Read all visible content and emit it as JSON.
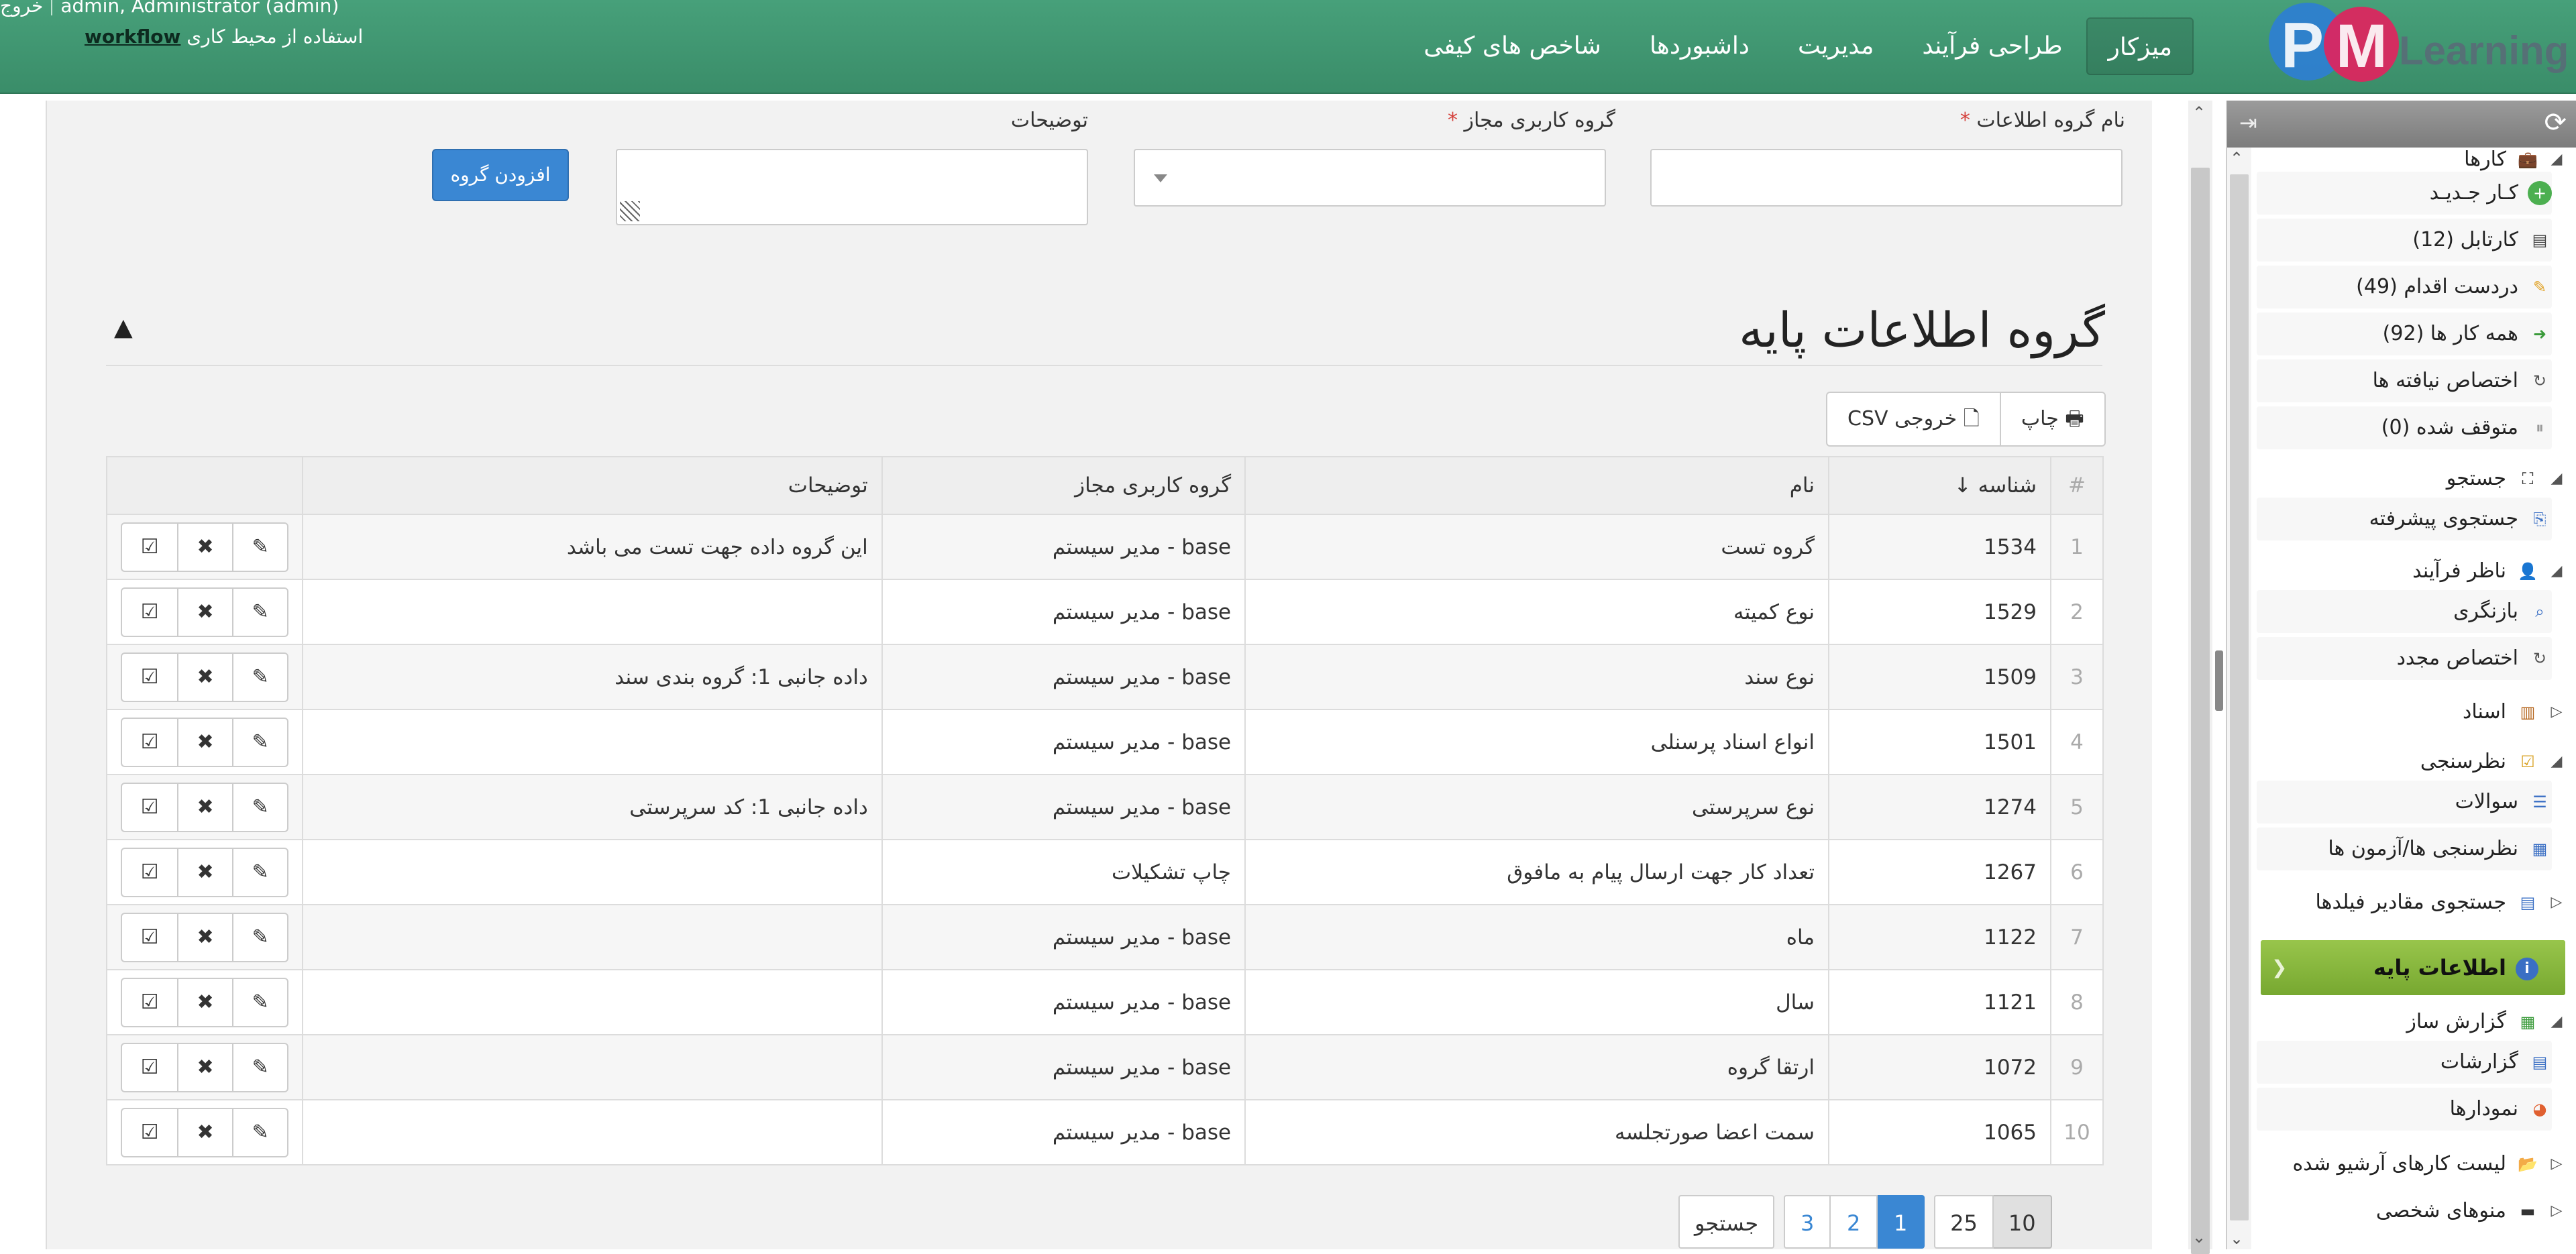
{
  "header": {
    "user_text": "admin, Administrator (admin)",
    "logout_label": "خروج",
    "workspace_prefix": "استفاده از محیط کاری",
    "workspace_name": "workflow",
    "logo_text": "Learning",
    "nav": [
      {
        "label": "میزکار",
        "active": true
      },
      {
        "label": "طراحی فرآیند"
      },
      {
        "label": "مدیریت"
      },
      {
        "label": "داشبوردها"
      },
      {
        "label": "شاخص های کیفی"
      }
    ]
  },
  "form": {
    "group_name_label": "نام گروه اطلاعات",
    "user_group_label": "گروه کاربری مجاز",
    "description_label": "توضیحات",
    "required_mark": "*",
    "add_button": "افزودن گروه"
  },
  "section": {
    "title": "گروه اطلاعات پایه",
    "print_label": "چاپ",
    "csv_label": "خروجی CSV"
  },
  "table": {
    "headers": {
      "index": "#",
      "id": "شناسه ↓",
      "name": "نام",
      "user_group": "گروه کاربری مجاز",
      "description": "توضیحات"
    },
    "rows": [
      {
        "index": "1",
        "id": "1534",
        "name": "گروه تست",
        "user_group": "base - مدیر سیستم",
        "description": "این گروه داده جهت تست می باشد"
      },
      {
        "index": "2",
        "id": "1529",
        "name": "نوع کمیته",
        "user_group": "base - مدیر سیستم",
        "description": ""
      },
      {
        "index": "3",
        "id": "1509",
        "name": "نوع سند",
        "user_group": "base - مدیر سیستم",
        "description": "داده جانبی 1: گروه بندی سند"
      },
      {
        "index": "4",
        "id": "1501",
        "name": "انواع اسناد پرسنلی",
        "user_group": "base - مدیر سیستم",
        "description": ""
      },
      {
        "index": "5",
        "id": "1274",
        "name": "نوع سرپرستی",
        "user_group": "base - مدیر سیستم",
        "description": "داده جانبی 1: کد سرپرستی"
      },
      {
        "index": "6",
        "id": "1267",
        "name": "تعداد کار جهت ارسال پیام به مافوق",
        "user_group": "چاپ تشکیلات",
        "description": ""
      },
      {
        "index": "7",
        "id": "1122",
        "name": "ماه",
        "user_group": "base - مدیر سیستم",
        "description": ""
      },
      {
        "index": "8",
        "id": "1121",
        "name": "سال",
        "user_group": "base - مدیر سیستم",
        "description": ""
      },
      {
        "index": "9",
        "id": "1072",
        "name": "ارتقا گروه",
        "user_group": "base - مدیر سیستم",
        "description": ""
      },
      {
        "index": "10",
        "id": "1065",
        "name": "سمت اعضا صورتجلسه",
        "user_group": "base - مدیر سیستم",
        "description": ""
      }
    ]
  },
  "pager": {
    "page_sizes": [
      "10",
      "25"
    ],
    "active_page_size": "10",
    "pages": [
      "1",
      "2",
      "3"
    ],
    "active_page": "1",
    "search_label": "جستجو"
  },
  "sidebar": {
    "items": [
      {
        "label": "کارها",
        "type": "group",
        "icon": "briefcase-icon"
      },
      {
        "label": "کـار جـدیـد",
        "type": "sub",
        "icon": "plus-circle-icon"
      },
      {
        "label": "کارتابل (12)",
        "type": "sub",
        "icon": "inbox-icon"
      },
      {
        "label": "دردست اقدام (49)",
        "type": "sub",
        "icon": "pencil-icon"
      },
      {
        "label": "همه کار ها (92)",
        "type": "sub",
        "icon": "document-arrow-icon"
      },
      {
        "label": "اختصاص نیافته ها",
        "type": "sub",
        "icon": "refresh-icon"
      },
      {
        "label": "متوقف شده (0)",
        "type": "sub",
        "icon": "pause-icon"
      },
      {
        "label": "جستجو",
        "type": "group",
        "icon": "binoculars-icon"
      },
      {
        "label": "جستجوی پیشرفته",
        "type": "sub",
        "icon": "search-doc-icon"
      },
      {
        "label": "ناظر فرآیند",
        "type": "group",
        "icon": "user-icon"
      },
      {
        "label": "بازنگری",
        "type": "sub",
        "icon": "magnifier-icon"
      },
      {
        "label": "اختصاص مجدد",
        "type": "sub",
        "icon": "refresh-icon"
      },
      {
        "label": "اسناد",
        "type": "group-collapsed",
        "icon": "book-icon"
      },
      {
        "label": "نظرسنجی",
        "type": "group",
        "icon": "survey-icon"
      },
      {
        "label": "سوالات",
        "type": "sub",
        "icon": "list-icon"
      },
      {
        "label": "نظرسنجی ها/آزمون ها",
        "type": "sub",
        "icon": "table-icon"
      },
      {
        "label": "جستجوی مقادیر فیلدها",
        "type": "group-collapsed",
        "icon": "form-icon"
      },
      {
        "label": "اطلاعات پایه",
        "type": "active",
        "icon": "info-icon"
      },
      {
        "label": "گزارش ساز",
        "type": "group",
        "icon": "report-builder-icon"
      },
      {
        "label": "گزارشات",
        "type": "sub",
        "icon": "report-icon"
      },
      {
        "label": "نمودارها",
        "type": "sub",
        "icon": "pie-chart-icon"
      },
      {
        "label": "لیست کارهای آرشیو شده",
        "type": "group-collapsed",
        "icon": "folder-open-icon"
      },
      {
        "label": "منوهای شخصی",
        "type": "group-collapsed",
        "icon": "folder-icon"
      }
    ]
  },
  "colors": {
    "header_green": "#47a07a",
    "primary_blue": "#3a87d3",
    "active_menu_green": "#8cbf44",
    "required_red": "#d43f3a"
  }
}
